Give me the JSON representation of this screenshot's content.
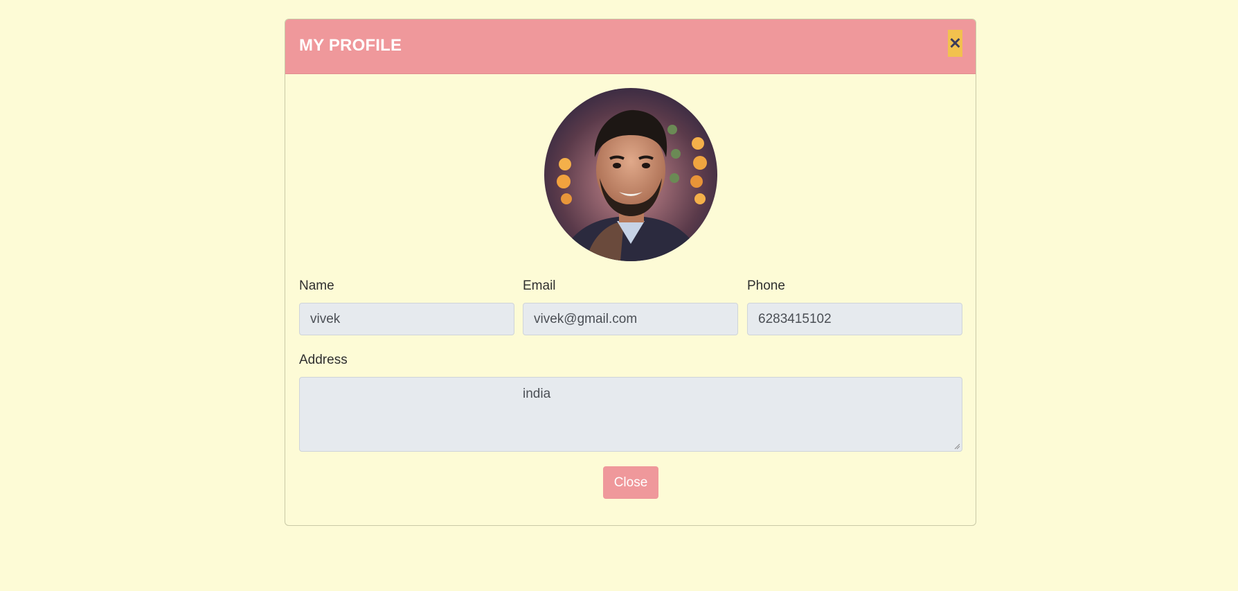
{
  "modal": {
    "title": "MY PROFILE",
    "close_icon_glyph": "✕"
  },
  "profile": {
    "avatar_icon": "user-photo",
    "fields": {
      "name_label": "Name",
      "name_value": "vivek",
      "email_label": "Email",
      "email_value": "vivek@gmail.com",
      "phone_label": "Phone",
      "phone_value": "6283415102",
      "address_label": "Address",
      "address_value": "india"
    }
  },
  "footer": {
    "close_label": "Close"
  },
  "colors": {
    "background": "#fdfbd6",
    "header": "#ef989b",
    "close_icon_bg": "#f2c14e",
    "input_bg": "#e6eaee"
  }
}
